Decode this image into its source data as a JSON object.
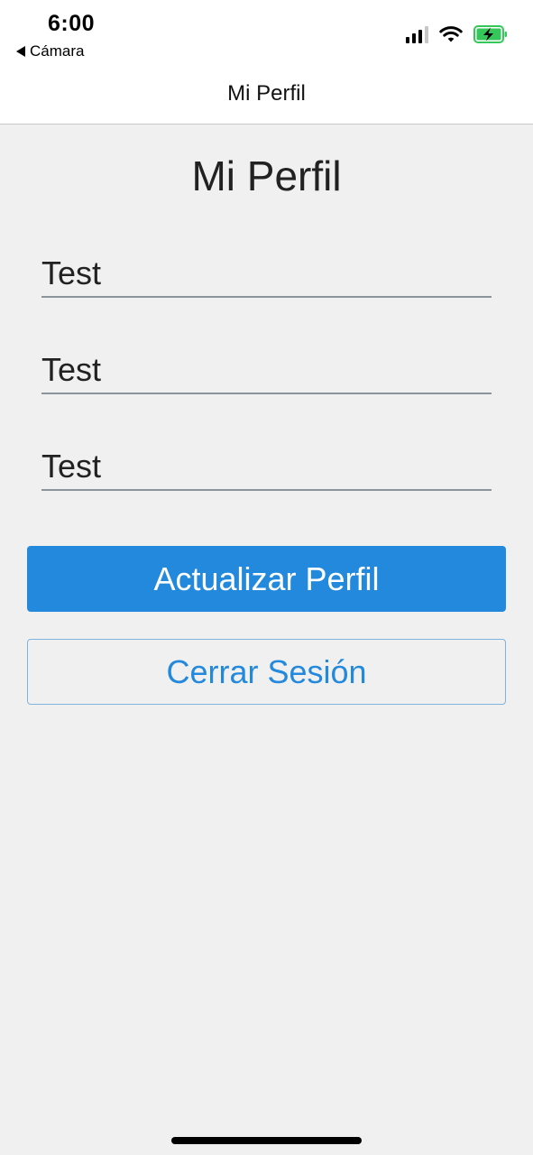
{
  "status_bar": {
    "time": "6:00",
    "back_label": "Cámara",
    "icons": [
      "cellular-signal-icon",
      "wifi-icon",
      "battery-charging-icon"
    ],
    "battery_color": "#35c759"
  },
  "header": {
    "title": "Mi Perfil"
  },
  "main": {
    "title": "Mi Perfil",
    "fields": [
      {
        "value": "Test"
      },
      {
        "value": "Test"
      },
      {
        "value": "Test"
      }
    ],
    "update_button_label": "Actualizar Perfil",
    "logout_button_label": "Cerrar Sesión"
  },
  "colors": {
    "accent": "#2389dc",
    "background": "#f0f0f0",
    "header_background": "#ffffff"
  }
}
